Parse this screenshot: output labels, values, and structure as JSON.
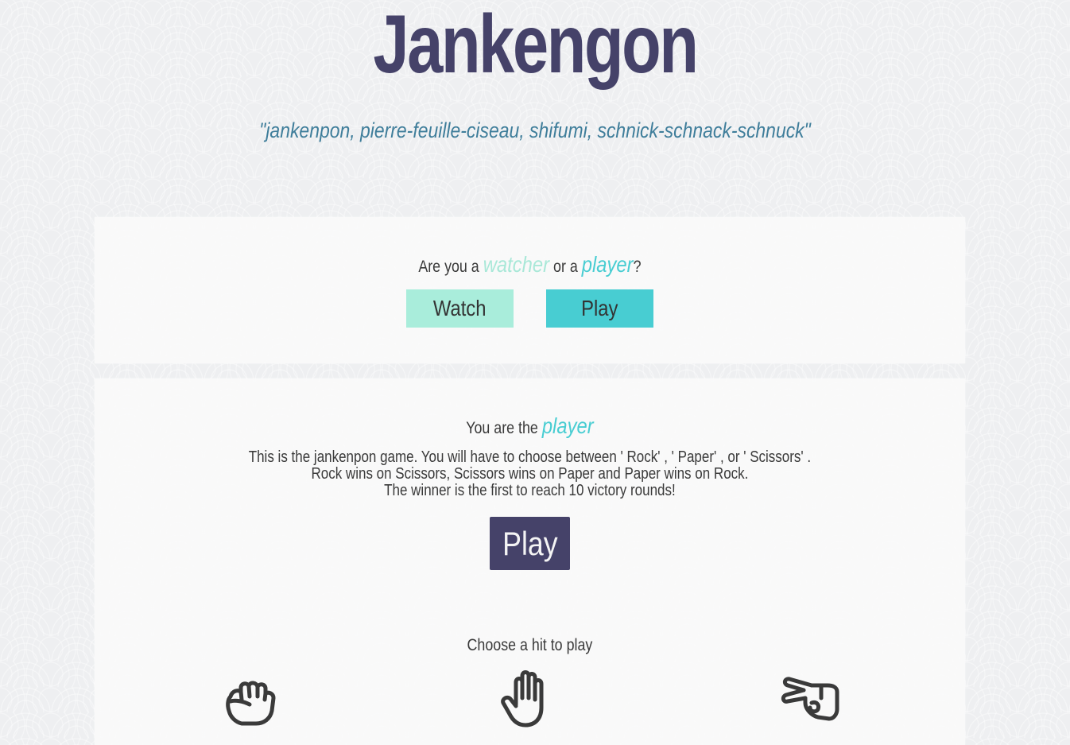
{
  "header": {
    "title": "Jankengon",
    "subtitle": "\"jankenpon, pierre-feuille-ciseau, shifumi, schnick-schnack-schnuck\""
  },
  "role_panel": {
    "question_prefix": "Are you a",
    "watcher_word": "watcher",
    "question_or": "or a",
    "player_word": "player",
    "question_suffix": "?",
    "watch_button": "Watch",
    "play_button": "Play"
  },
  "game_panel": {
    "you_are_prefix": "You are the",
    "role_word": "player",
    "rules": [
      "This is the jankenpon game. You will have to choose between ' Rock' , ' Paper' , or ' Scissors' .",
      "Rock wins on Scissors, Scissors wins on Paper and Paper wins on Rock.",
      "The winner is the first to reach 10 victory rounds!"
    ],
    "play_button": "Play",
    "choose_label": "Choose a hit to play",
    "hands": [
      {
        "name": "rock",
        "icon": "hand-rock-icon"
      },
      {
        "name": "paper",
        "icon": "hand-paper-icon"
      },
      {
        "name": "scissors",
        "icon": "hand-scissors-icon"
      }
    ]
  },
  "colors": {
    "title": "#454269",
    "subtitle": "#3e7d9a",
    "watch_button": "#a9eddb",
    "play_accent": "#48cdd2",
    "main_button": "#454269"
  }
}
